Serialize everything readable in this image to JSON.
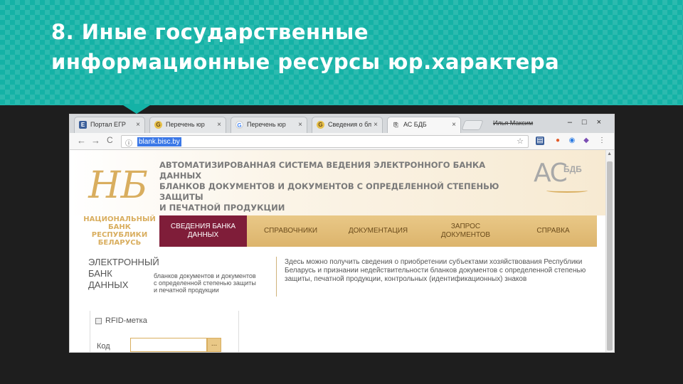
{
  "slide": {
    "title_line1": "8. Иные государственные",
    "title_line2": "информационные ресурсы юр.характера"
  },
  "browser": {
    "tabs": [
      {
        "icon": "egr-icon",
        "label": "Портал ЕГР",
        "close": "×"
      },
      {
        "icon": "google-icon",
        "label": "Перечень юр",
        "close": "×"
      },
      {
        "icon": "google-icon",
        "label": "Перечень юр",
        "close": "×"
      },
      {
        "icon": "google-icon",
        "label": "Сведения о бл",
        "close": "×"
      },
      {
        "icon": "page-icon",
        "label": "АС БДБ",
        "close": "×"
      }
    ],
    "window_name": "Илья Максим",
    "window_controls": "–□×",
    "nav": {
      "back": "←",
      "forward": "→",
      "reload": "C"
    },
    "url": "blank.bisc.by",
    "info_glyph": "ⓘ",
    "star_glyph": "☆"
  },
  "site": {
    "logo_glyph": "НБ",
    "header_lines": [
      "АВТОМАТИЗИРОВАННАЯ СИСТЕМА ВЕДЕНИЯ ЭЛЕКТРОННОГО БАНКА ДАННЫХ",
      "БЛАНКОВ ДОКУМЕНТОВ И ДОКУМЕНТОВ С ОПРЕДЕЛЕННОЙ СТЕПЕНЬЮ ЗАЩИТЫ",
      "И ПЕЧАТНОЙ ПРОДУКЦИИ"
    ],
    "brand_as": "АС",
    "brand_bdb": "БДБ",
    "bank_name": [
      "НАЦИОНАЛЬНЫЙ",
      "БАНК",
      "РЕСПУБЛИКИ",
      "БЕЛАРУСЬ"
    ],
    "nav": [
      {
        "line1": "СВЕДЕНИЯ БАНКА",
        "line2": "ДАННЫХ",
        "active": true
      },
      {
        "line1": "СПРАВОЧНИКИ",
        "line2": "",
        "active": false
      },
      {
        "line1": "ДОКУМЕНТАЦИЯ",
        "line2": "",
        "active": false
      },
      {
        "line1": "ЗАПРОС",
        "line2": "ДОКУМЕНТОВ",
        "active": false
      },
      {
        "line1": "СПРАВКА",
        "line2": "",
        "active": false
      }
    ],
    "db_title": [
      "ЭЛЕКТРОННЫЙ",
      "БАНК",
      "ДАННЫХ"
    ],
    "db_subtitle": [
      "бланков документов и документов",
      "с определенной степенью защиты",
      "и печатной продукции"
    ],
    "description": "Здесь можно получить сведения о приобретении субъектами хозяйствования Республики Беларусь и признании недействительности бланков документов с определенной степенью защиты, печатной продукции, контрольных (идентификационных) знаков",
    "rfid_label": "RFID-метка",
    "kod_label": "Код",
    "kod_value": "",
    "kod_button": "..."
  }
}
